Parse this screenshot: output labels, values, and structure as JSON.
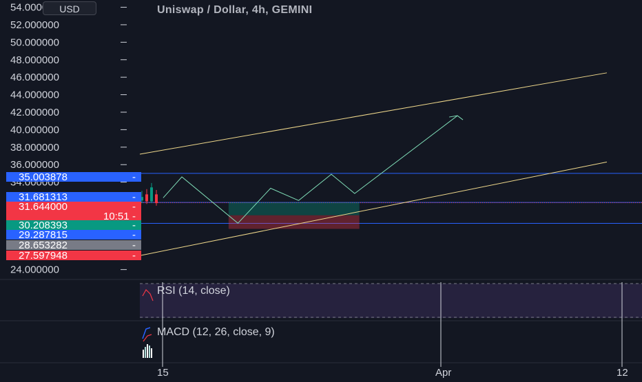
{
  "header": {
    "title": "Uniswap / Dollar, 4h, GEMINI",
    "currency_button": "USD"
  },
  "chart_data": {
    "type": "line",
    "title": "Uniswap / Dollar, 4h, GEMINI",
    "ylim": [
      23.5,
      54.2
    ],
    "y_ticks": [
      "24.000000",
      "34.000000",
      "36.000000",
      "38.000000",
      "40.000000",
      "42.000000",
      "44.000000",
      "46.000000",
      "48.000000",
      "50.000000",
      "52.000000",
      "54.000000"
    ],
    "x_ticks": [
      "15",
      "Apr",
      "12"
    ],
    "price_badges": [
      {
        "text": "35.003878",
        "color": "#2962ff",
        "value": 35.003878
      },
      {
        "text": "31.681313",
        "color": "#2962ff",
        "value": 31.681313
      },
      {
        "text": "31.644000",
        "color": "#f23645",
        "value": 31.644
      },
      {
        "text": "10:51",
        "color": "#f23645",
        "value": 31.644
      },
      {
        "text": "30.208393",
        "color": "#089981",
        "value": 30.208393
      },
      {
        "text": "29.287815",
        "color": "#2962ff",
        "value": 29.287815
      },
      {
        "text": "28.653282",
        "color": "#787b86",
        "value": 28.653282
      },
      {
        "text": "27.597948",
        "color": "#f23645",
        "value": 27.597948
      }
    ],
    "horizontal_lines": [
      35.003878,
      31.681313,
      29.287815
    ],
    "current_price": 31.644,
    "channel_upper": [
      {
        "x": 0.0,
        "y": 37.2
      },
      {
        "x": 1.0,
        "y": 46.5
      }
    ],
    "channel_lower": [
      {
        "x": 0.0,
        "y": 25.6
      },
      {
        "x": 1.0,
        "y": 36.3
      }
    ],
    "projection_path": [
      {
        "x": 0.05,
        "y": 32.2
      },
      {
        "x": 0.09,
        "y": 34.6
      },
      {
        "x": 0.21,
        "y": 29.3
      },
      {
        "x": 0.28,
        "y": 33.3
      },
      {
        "x": 0.34,
        "y": 31.9
      },
      {
        "x": 0.41,
        "y": 34.9
      },
      {
        "x": 0.46,
        "y": 32.7
      },
      {
        "x": 0.68,
        "y": 41.6
      }
    ],
    "position_box": {
      "x_start": 0.19,
      "x_end": 0.47,
      "entry": 30.208393,
      "target": 31.681313,
      "stop": 28.653282
    },
    "candles": [
      {
        "x": 0.0,
        "open": 31.9,
        "close": 32.3,
        "high": 33.0,
        "low": 31.6,
        "dir": "up"
      },
      {
        "x": 0.007,
        "open": 32.6,
        "close": 31.8,
        "high": 33.2,
        "low": 31.5,
        "dir": "down"
      },
      {
        "x": 0.014,
        "open": 31.8,
        "close": 33.4,
        "high": 33.9,
        "low": 31.6,
        "dir": "up"
      },
      {
        "x": 0.021,
        "open": 32.6,
        "close": 31.6,
        "high": 33.1,
        "low": 31.3,
        "dir": "down"
      }
    ]
  },
  "indicators": {
    "rsi": {
      "label": "RSI (14, close)",
      "upper_band": 70,
      "lower_band": 30
    },
    "macd": {
      "label": "MACD (12, 26, close, 9)"
    }
  },
  "colors": {
    "background": "#131722",
    "channel": "#f0d98c",
    "projection": "#7fdcb7",
    "hline": "#2962ff",
    "up": "#089981",
    "down": "#f23645",
    "rsi_band": "#7e57c2"
  }
}
